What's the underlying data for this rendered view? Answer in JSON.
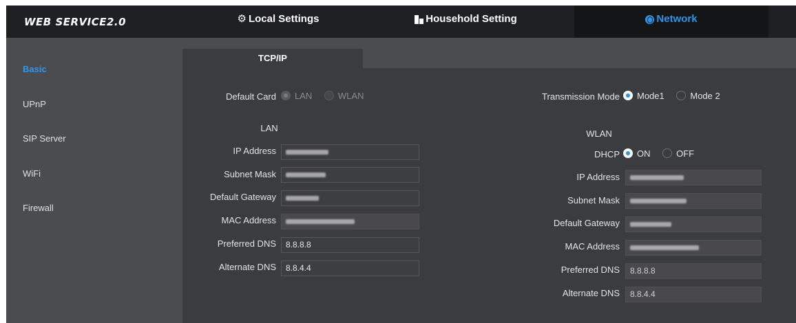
{
  "header": {
    "brand": "WEB SERVICE2.0",
    "tabs": [
      {
        "label": "Local Settings",
        "icon": "gear-icon"
      },
      {
        "label": "Household Setting",
        "icon": "building-icon"
      },
      {
        "label": "Network",
        "icon": "globe-icon",
        "active": true
      }
    ]
  },
  "sidebar": {
    "items": [
      {
        "label": "Basic",
        "active": true
      },
      {
        "label": "UPnP"
      },
      {
        "label": "SIP Server"
      },
      {
        "label": "WiFi"
      },
      {
        "label": "Firewall"
      }
    ]
  },
  "content": {
    "tab": "TCP/IP",
    "default_card": {
      "label": "Default Card",
      "options": [
        "LAN",
        "WLAN"
      ],
      "selected": "LAN",
      "disabled": true
    },
    "transmission_mode": {
      "label": "Transmission Mode",
      "options": [
        "Mode1",
        "Mode 2"
      ],
      "selected": "Mode1"
    },
    "lan": {
      "title": "LAN",
      "ip_address_label": "IP Address",
      "subnet_mask_label": "Subnet Mask",
      "default_gateway_label": "Default Gateway",
      "mac_address_label": "MAC Address",
      "preferred_dns_label": "Preferred DNS",
      "preferred_dns": "8.8.8.8",
      "alternate_dns_label": "Alternate DNS",
      "alternate_dns": "8.8.4.4"
    },
    "wlan": {
      "title": "WLAN",
      "dhcp_label": "DHCP",
      "dhcp_options": [
        "ON",
        "OFF"
      ],
      "dhcp_selected": "ON",
      "ip_address_label": "IP Address",
      "subnet_mask_label": "Subnet Mask",
      "default_gateway_label": "Default Gateway",
      "mac_address_label": "MAC Address",
      "preferred_dns_label": "Preferred DNS",
      "preferred_dns": "8.8.8.8",
      "alternate_dns_label": "Alternate DNS",
      "alternate_dns": "8.8.4.4"
    }
  },
  "colors": {
    "accent": "#2f95e8",
    "topbar": "#1e1f22",
    "panel": "#3b3c40",
    "frame": "#4b4c50"
  }
}
